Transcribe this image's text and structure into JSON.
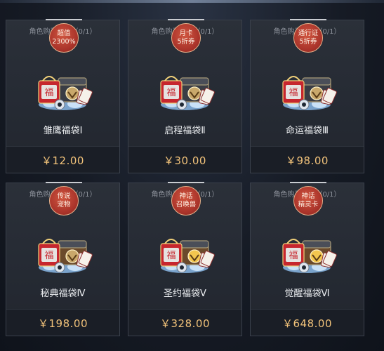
{
  "cards": [
    {
      "limit": "角色购买限制（0/1）",
      "name": "雏鹰福袋Ⅰ",
      "price": "￥12.00",
      "badge": [
        "超值",
        "2300%"
      ],
      "icon": "lucky-bag-bundle-icon"
    },
    {
      "limit": "角色购买限制（0/1）",
      "name": "启程福袋Ⅱ",
      "price": "￥30.00",
      "badge": [
        "月卡",
        "5折券"
      ],
      "icon": "lucky-bag-bundle-icon"
    },
    {
      "limit": "角色购买限制（0/1）",
      "name": "命运福袋Ⅲ",
      "price": "￥98.00",
      "badge": [
        "通行证",
        "5折券"
      ],
      "icon": "lucky-bag-bundle-icon"
    },
    {
      "limit": "角色购买限制（0/1）",
      "name": "秘典福袋Ⅳ",
      "price": "￥198.00",
      "badge": [
        "传说",
        "宠物"
      ],
      "icon": "lucky-bag-bundle-icon"
    },
    {
      "limit": "角色购买限制（0/1）",
      "name": "圣约福袋Ⅴ",
      "price": "￥328.00",
      "badge": [
        "神话",
        "召唤兽"
      ],
      "icon": "lucky-bag-bundle-icon"
    },
    {
      "limit": "角色购买限制（0/1）",
      "name": "觉醒福袋Ⅵ",
      "price": "￥648.00",
      "badge": [
        "神话",
        "精灵卡"
      ],
      "icon": "lucky-bag-bundle-icon"
    }
  ],
  "colors": {
    "price": "#f1c27a",
    "badge": "#b03a2e",
    "card": "#262b34"
  }
}
